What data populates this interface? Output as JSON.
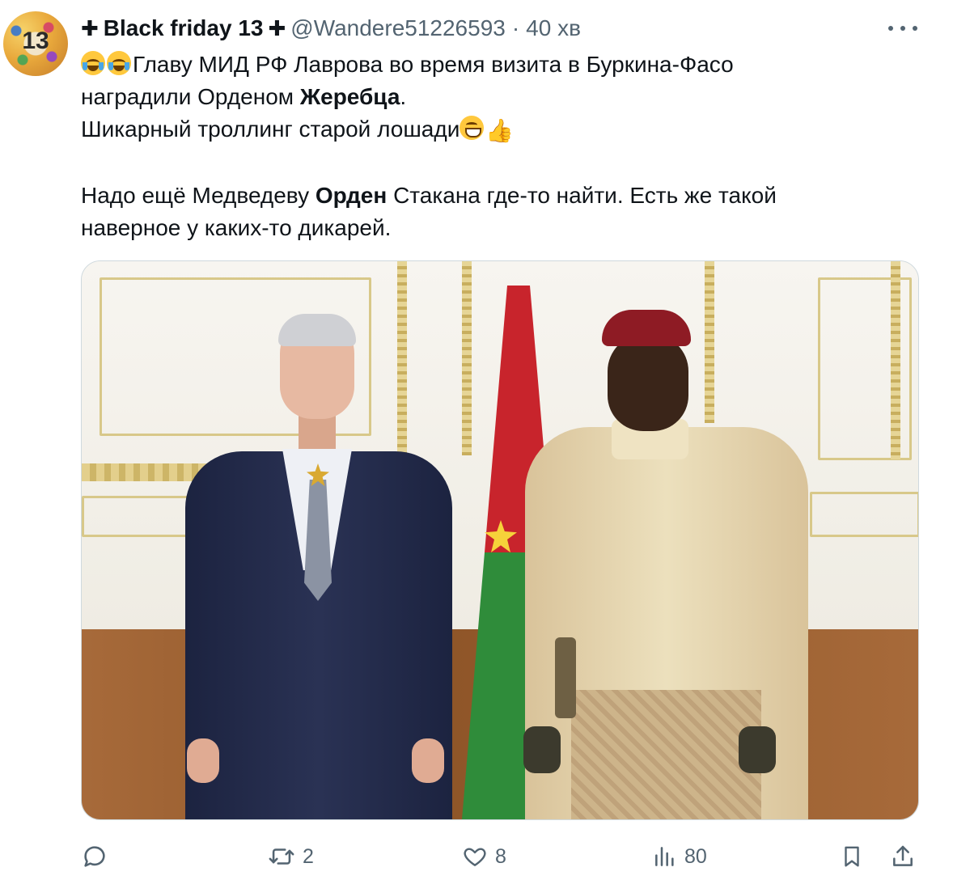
{
  "author": {
    "cross_left": "✚",
    "display_name": "Black friday 13",
    "cross_right": "✚",
    "handle": "@Wandere51226593",
    "separator": "·",
    "time": "40 хв",
    "avatar_text": "13"
  },
  "tweet": {
    "line1": "Главу МИД РФ Лаврова во время визита в Буркина-Фасо",
    "line2_a": "наградили Орденом ",
    "line2_bold": "Жеребца",
    "line2_b": ".",
    "line3": "Шикарный троллинг старой лошади",
    "line4_a": "Надо ещё Медведеву ",
    "line4_bold": "Орден",
    "line4_b": " Стакана где-то найти. Есть же такой",
    "line5": "наверное у каких-то дикарей."
  },
  "actions": {
    "replies": "",
    "reposts": "2",
    "likes": "8",
    "views": "80"
  },
  "colors": {
    "text": "#0f1419",
    "secondary": "#536471",
    "border": "#cfd9de"
  }
}
